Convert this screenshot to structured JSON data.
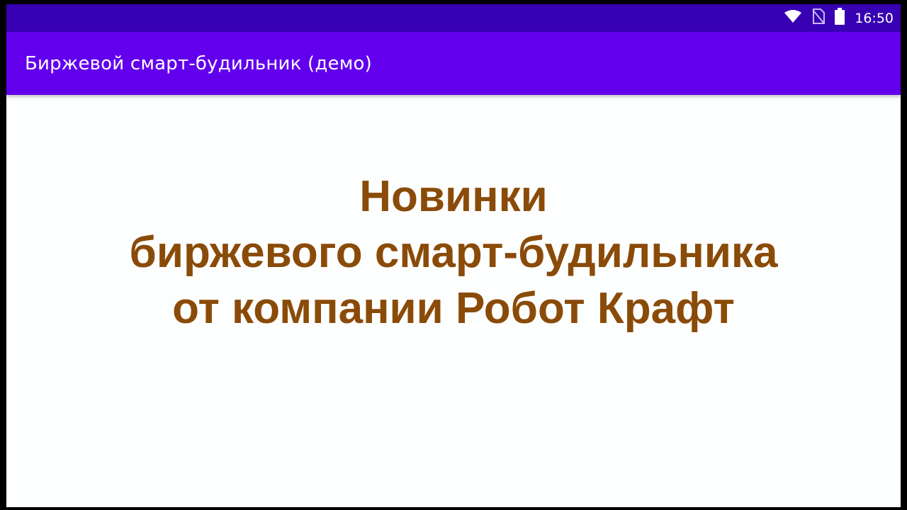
{
  "status_bar": {
    "time": "16:50",
    "icons": [
      "wifi-icon",
      "no-sim-icon",
      "battery-icon"
    ]
  },
  "app_bar": {
    "title": "Биржевой смарт-будильник (демо)",
    "background": "#6200ee"
  },
  "main": {
    "headline_lines": [
      "Новинки",
      "биржевого смарт-будильника",
      "от компании Робот Крафт"
    ],
    "headline_color": "#8a4b08"
  }
}
